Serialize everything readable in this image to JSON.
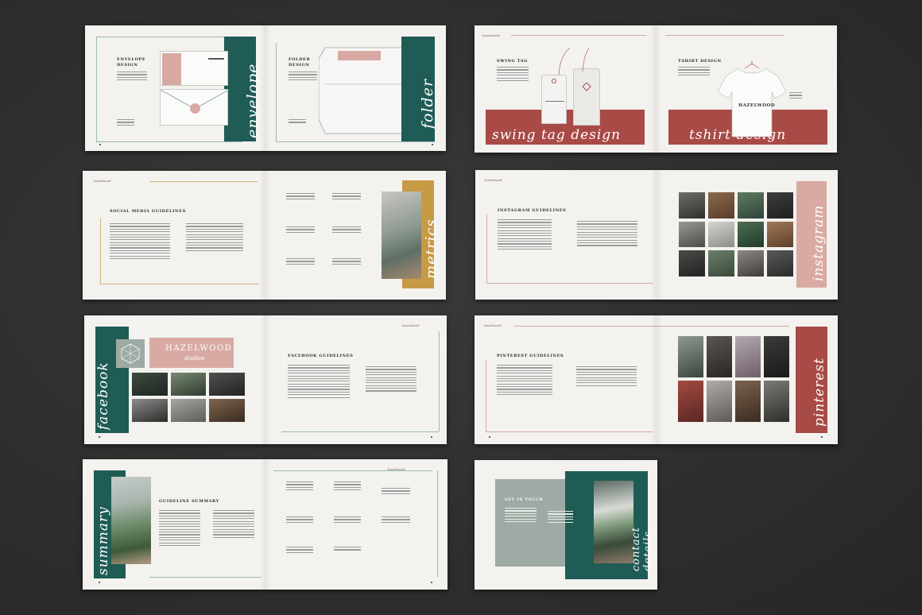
{
  "brand": {
    "name": "HAZELWOOD",
    "tagline": "studios"
  },
  "colors": {
    "teal": "#1f5c55",
    "rose": "#d9aaa3",
    "terracotta": "#a84a46",
    "mustard": "#c79a45",
    "paper": "#f3f2ef",
    "sage": "#9eaaa3"
  },
  "spread1": {
    "envelope_title": "ENVELOPE\nDESIGN",
    "folder_title": "FOLDER\nDESIGN",
    "envelope_script": "envelope",
    "folder_script": "folder"
  },
  "spread2": {
    "swing_title": "SWING TAG",
    "tshirt_title": "TSHIRT DESIGN",
    "swing_script": "swing tag design",
    "tshirt_script": "tshirt design"
  },
  "spread3": {
    "title": "SOCIAL MEDIA GUIDELINES",
    "script": "metrics"
  },
  "spread4": {
    "title": "INSTAGRAM GUIDELINES",
    "script": "instagram"
  },
  "spread5": {
    "title": "FACEBOOK GUIDELINES",
    "script": "facebook",
    "logo_name": "HAZELWOOD",
    "logo_tag": "studios"
  },
  "spread6": {
    "title": "PINTEREST GUIDELINES",
    "script": "pinterest"
  },
  "spread7": {
    "title": "GUIDELINE SUMMARY",
    "script": "summary"
  },
  "spread8": {
    "title": "GET IN TOUCH",
    "script": "contact details"
  }
}
